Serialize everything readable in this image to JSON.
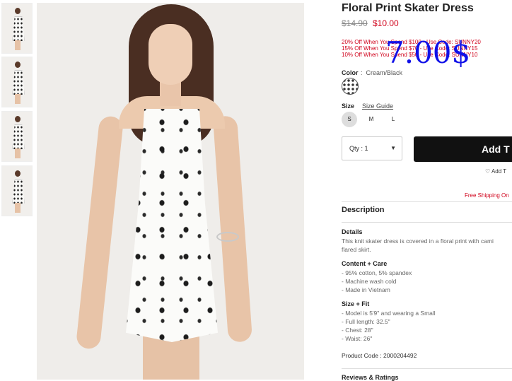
{
  "product": {
    "title": "Floral Print Skater Dress",
    "price_old": "$14.90",
    "price_new": "$10.00",
    "promos": [
      "20% Off When You Spend $100 - Use Code: SUNNY20",
      "15% Off When You Spend $70 - Use Code: SUNNY15",
      "10% Off When You Spend $50 - Use Code: SUNNY10"
    ],
    "overlay_price": "7.00$"
  },
  "color": {
    "label": "Color",
    "separator": ":",
    "value": "Cream/Black"
  },
  "size": {
    "label": "Size",
    "guide": "Size Guide",
    "options": [
      "S",
      "M",
      "L"
    ],
    "selected": "S"
  },
  "qty": {
    "label": "Qty : 1"
  },
  "add_button": "Add T",
  "wishlist": "Add T",
  "free_shipping": "Free Shipping On",
  "description": {
    "title": "Description",
    "details_h": "Details",
    "details_lines": [
      "This knit skater dress is covered in a floral print with cami",
      "flared skirt."
    ],
    "content_h": "Content + Care",
    "content_lines": [
      "- 95% cotton, 5% spandex",
      "- Machine wash cold",
      "- Made in Vietnam"
    ],
    "fit_h": "Size + Fit",
    "fit_lines": [
      "- Model is 5'9\" and wearing a Small",
      "- Full length: 32.5\"",
      "- Chest: 28\"",
      "- Waist: 26\""
    ],
    "product_code": "Product Code : 2000204492",
    "reviews": "Reviews & Ratings"
  },
  "icons": {
    "caret": "caret-down-icon",
    "heart": "heart-icon"
  },
  "colors": {
    "accent": "#d0021b",
    "button": "#111111",
    "overlay": "#1010e8"
  }
}
